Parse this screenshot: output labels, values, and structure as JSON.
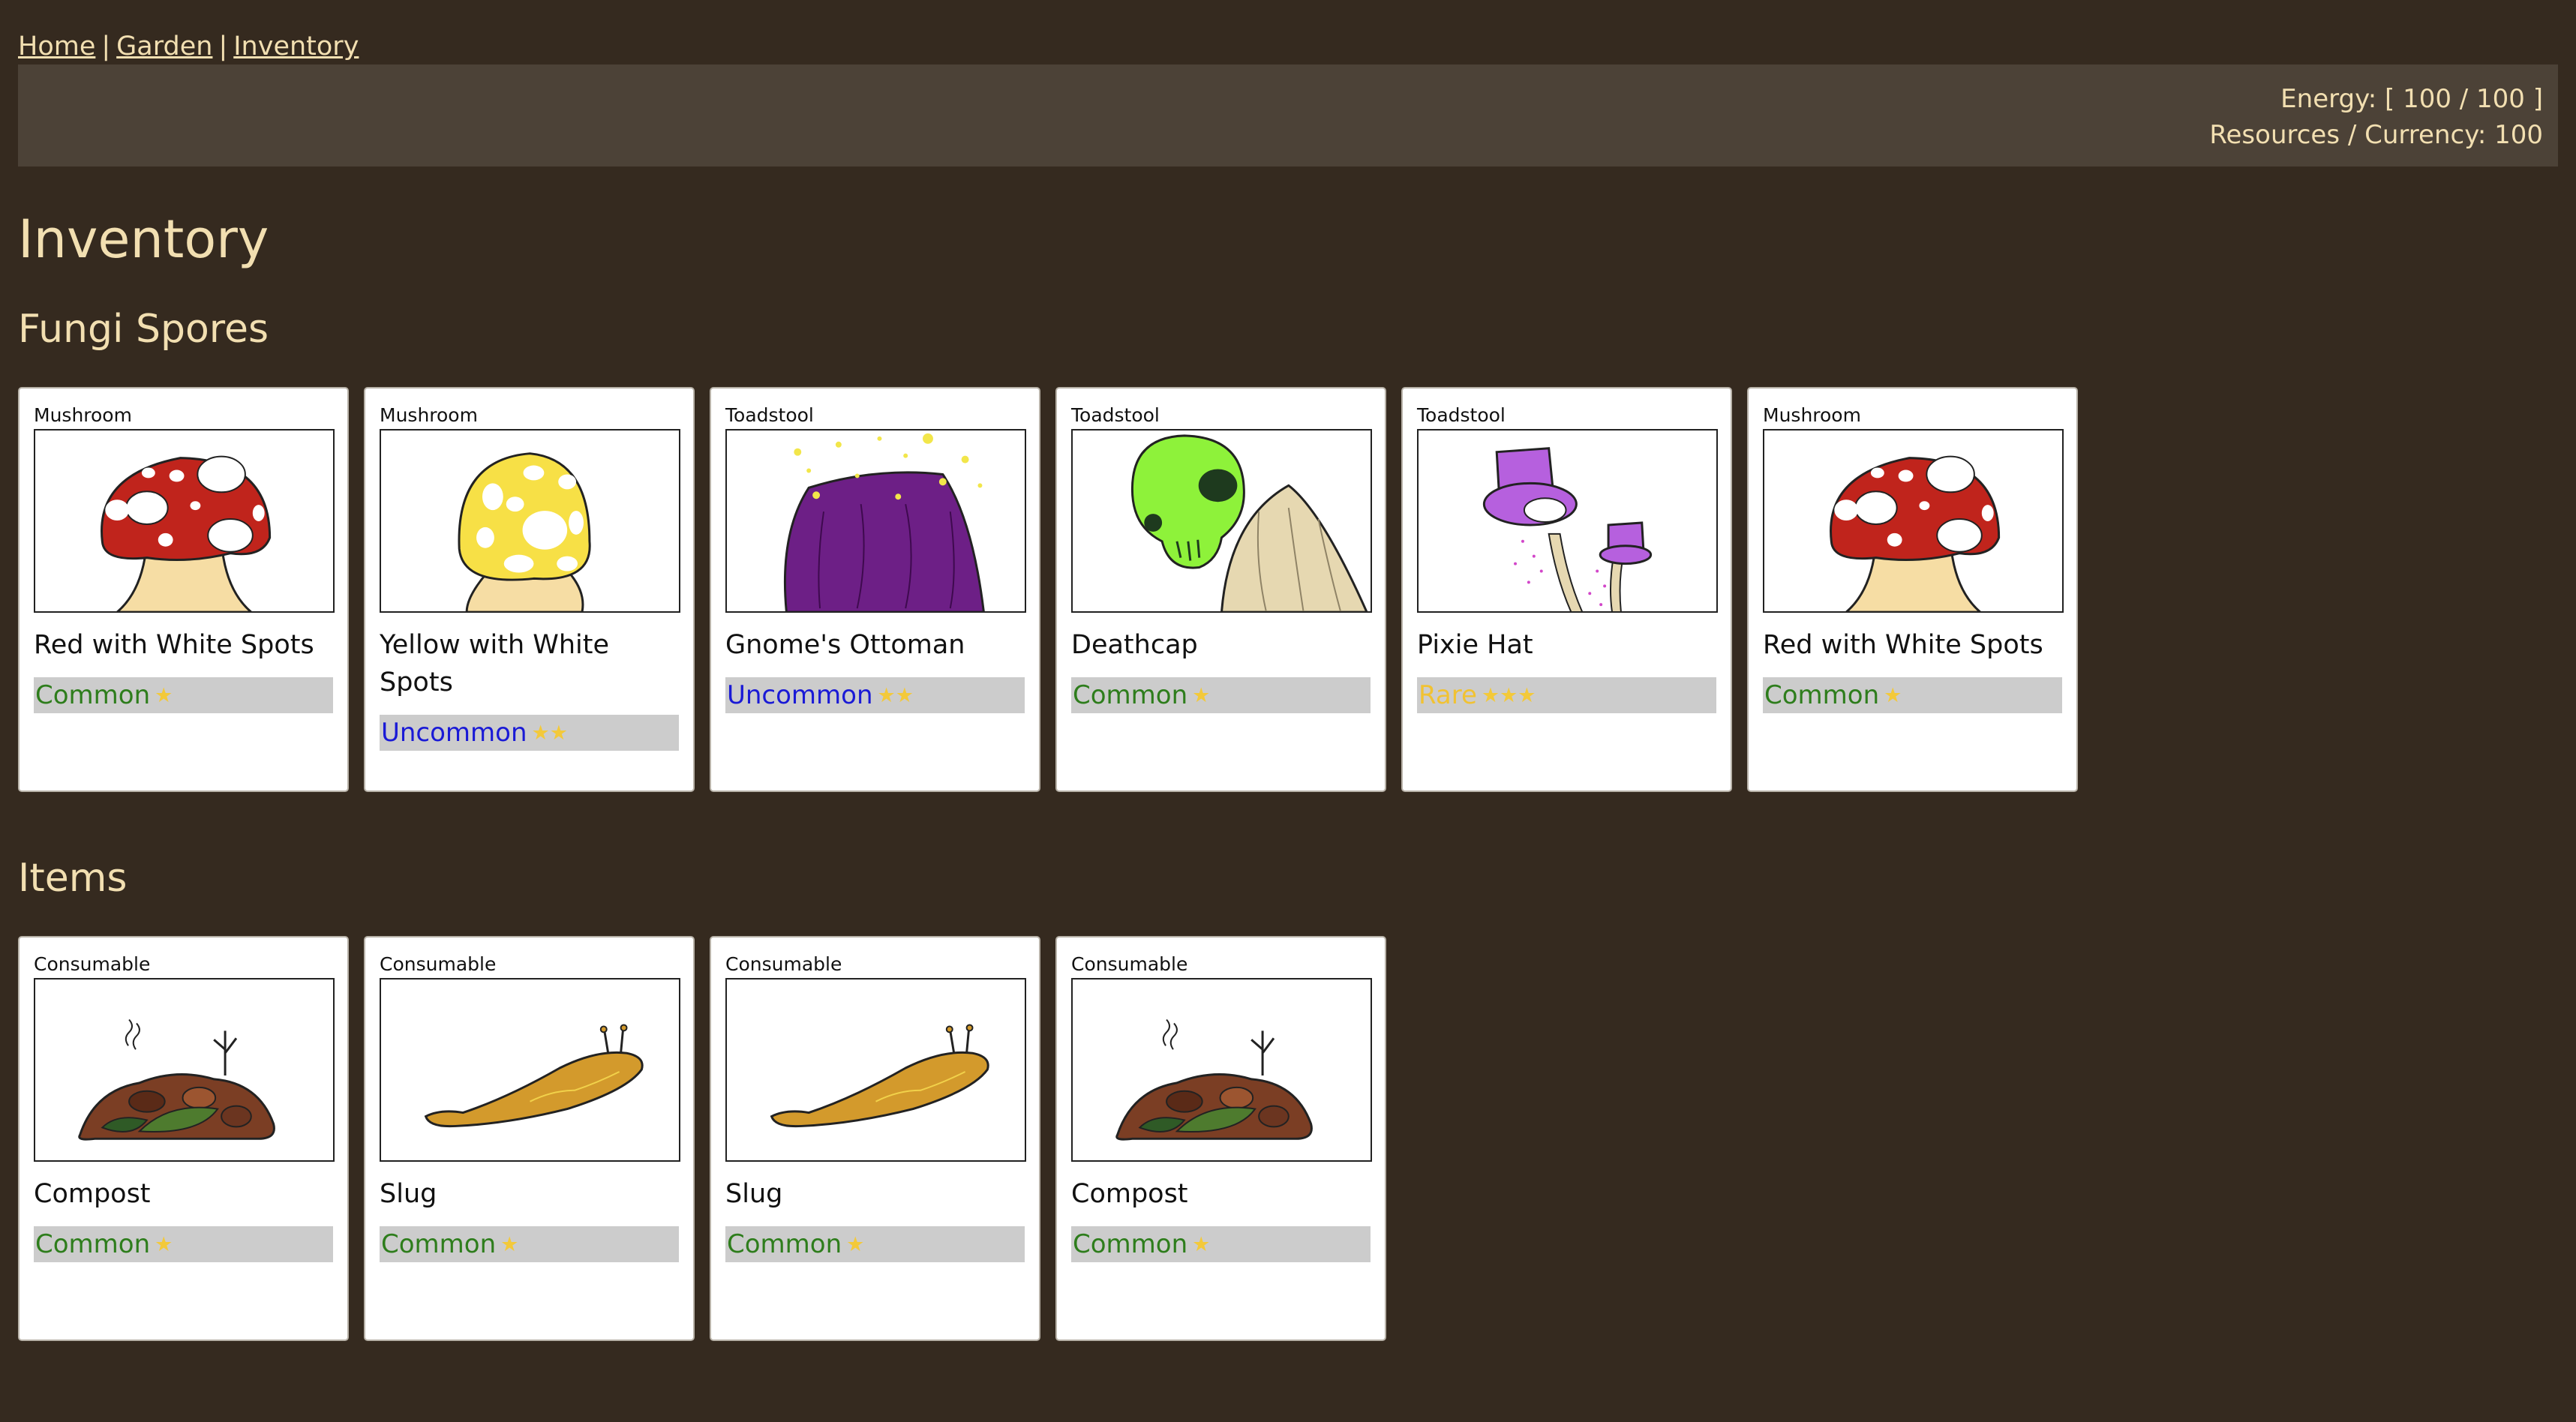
{
  "nav": {
    "home": "Home",
    "garden": "Garden",
    "inventory": "Inventory",
    "separator": "|"
  },
  "status": {
    "energy": "Energy: [ 100 / 100 ]",
    "currency": "Resources / Currency: 100"
  },
  "page_title": "Inventory",
  "fungi": {
    "title": "Fungi Spores",
    "cards": [
      {
        "type": "Mushroom",
        "name": "Red with White Spots",
        "rarity": "Common",
        "stars": "★",
        "rarity_color": "#2e7d1c",
        "icon": "red-spotted-mushroom"
      },
      {
        "type": "Mushroom",
        "name": "Yellow with White Spots",
        "rarity": "Uncommon",
        "stars": "★★",
        "rarity_color": "#1a1ad6",
        "icon": "yellow-spotted-mushroom"
      },
      {
        "type": "Toadstool",
        "name": "Gnome's Ottoman",
        "rarity": "Uncommon",
        "stars": "★★",
        "rarity_color": "#1a1ad6",
        "icon": "purple-ottoman-toadstool"
      },
      {
        "type": "Toadstool",
        "name": "Deathcap",
        "rarity": "Common",
        "stars": "★",
        "rarity_color": "#2e7d1c",
        "icon": "skull-toadstool"
      },
      {
        "type": "Toadstool",
        "name": "Pixie Hat",
        "rarity": "Rare",
        "stars": "★★★",
        "rarity_color": "#f1c232",
        "icon": "purple-top-hat-toadstool"
      },
      {
        "type": "Mushroom",
        "name": "Red with White Spots",
        "rarity": "Common",
        "stars": "★",
        "rarity_color": "#2e7d1c",
        "icon": "red-spotted-mushroom"
      }
    ]
  },
  "items": {
    "title": "Items",
    "cards": [
      {
        "type": "Consumable",
        "name": "Compost",
        "rarity": "Common",
        "stars": "★",
        "rarity_color": "#2e7d1c",
        "icon": "compost-pile"
      },
      {
        "type": "Consumable",
        "name": "Slug",
        "rarity": "Common",
        "stars": "★",
        "rarity_color": "#2e7d1c",
        "icon": "slug"
      },
      {
        "type": "Consumable",
        "name": "Slug",
        "rarity": "Common",
        "stars": "★",
        "rarity_color": "#2e7d1c",
        "icon": "slug"
      },
      {
        "type": "Consumable",
        "name": "Compost",
        "rarity": "Common",
        "stars": "★",
        "rarity_color": "#2e7d1c",
        "icon": "compost-pile"
      }
    ]
  }
}
